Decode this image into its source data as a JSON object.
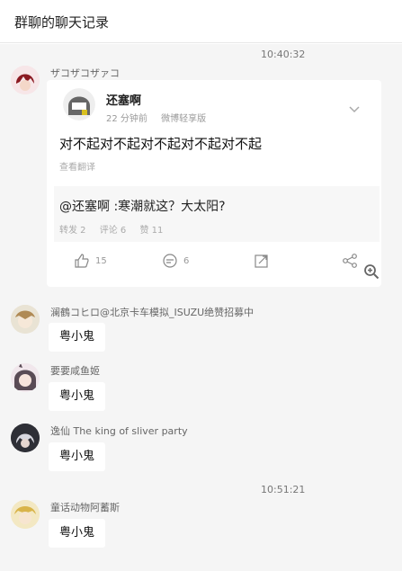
{
  "window": {
    "title": "群聊的聊天记录"
  },
  "messages": [
    {
      "time": "10:40:32",
      "sender": "ザコザコザァコ",
      "card": {
        "user": "还塞啊",
        "time": "22 分钟前",
        "source": "微博轻享版",
        "text": "对不起对不起对不起对不起对不起",
        "translate": "查看翻译",
        "quote": {
          "text": "@还塞啊 :寒潮就这？大太阳?",
          "reposts": "转发 2",
          "comments": "评论 6",
          "likes": "赞 11"
        },
        "actions": {
          "like": "15",
          "comment": "6"
        }
      }
    },
    {
      "sender": "澜鶴コヒロ@北京卡车模拟_ISUZU绝赞招募中",
      "text": "粤小鬼"
    },
    {
      "sender": "要要咸鱼姬",
      "text": "粤小鬼"
    },
    {
      "sender": "逸仙 The king of sliver party",
      "text": "粤小鬼"
    },
    {
      "time": "10:51:21",
      "sender": "童话动物阿蓄斯",
      "text": "粤小鬼"
    }
  ],
  "colors": {
    "chat_bg": "#f5f5f5",
    "bubble": "#ffffff",
    "meta": "#999999"
  }
}
